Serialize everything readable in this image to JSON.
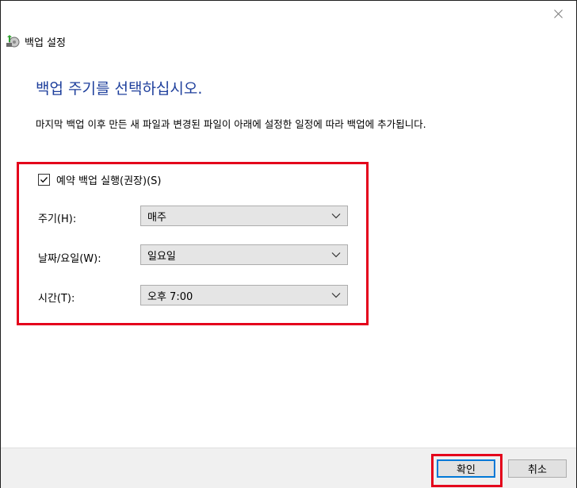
{
  "window": {
    "title": "백업 설정",
    "close_icon": "close-icon",
    "app_icon": "backup-icon"
  },
  "content": {
    "heading": "백업 주기를 선택하십시오.",
    "description": "마지막 백업 이후 만든 새 파일과 변경된 파일이 아래에 설정한 일정에 따라 백업에 추가됩니다."
  },
  "schedule": {
    "run_scheduled_label": "예약 백업 실행(권장)(S)",
    "run_scheduled_checked": true,
    "frequency_label": "주기(H):",
    "frequency_value": "매주",
    "day_label": "날짜/요일(W):",
    "day_value": "일요일",
    "time_label": "시간(T):",
    "time_value": "오후 7:00"
  },
  "buttons": {
    "ok_label": "확인",
    "cancel_label": "취소"
  },
  "colors": {
    "heading": "#1e3f9c",
    "highlight": "#e4001b",
    "focus": "#0078d7"
  }
}
